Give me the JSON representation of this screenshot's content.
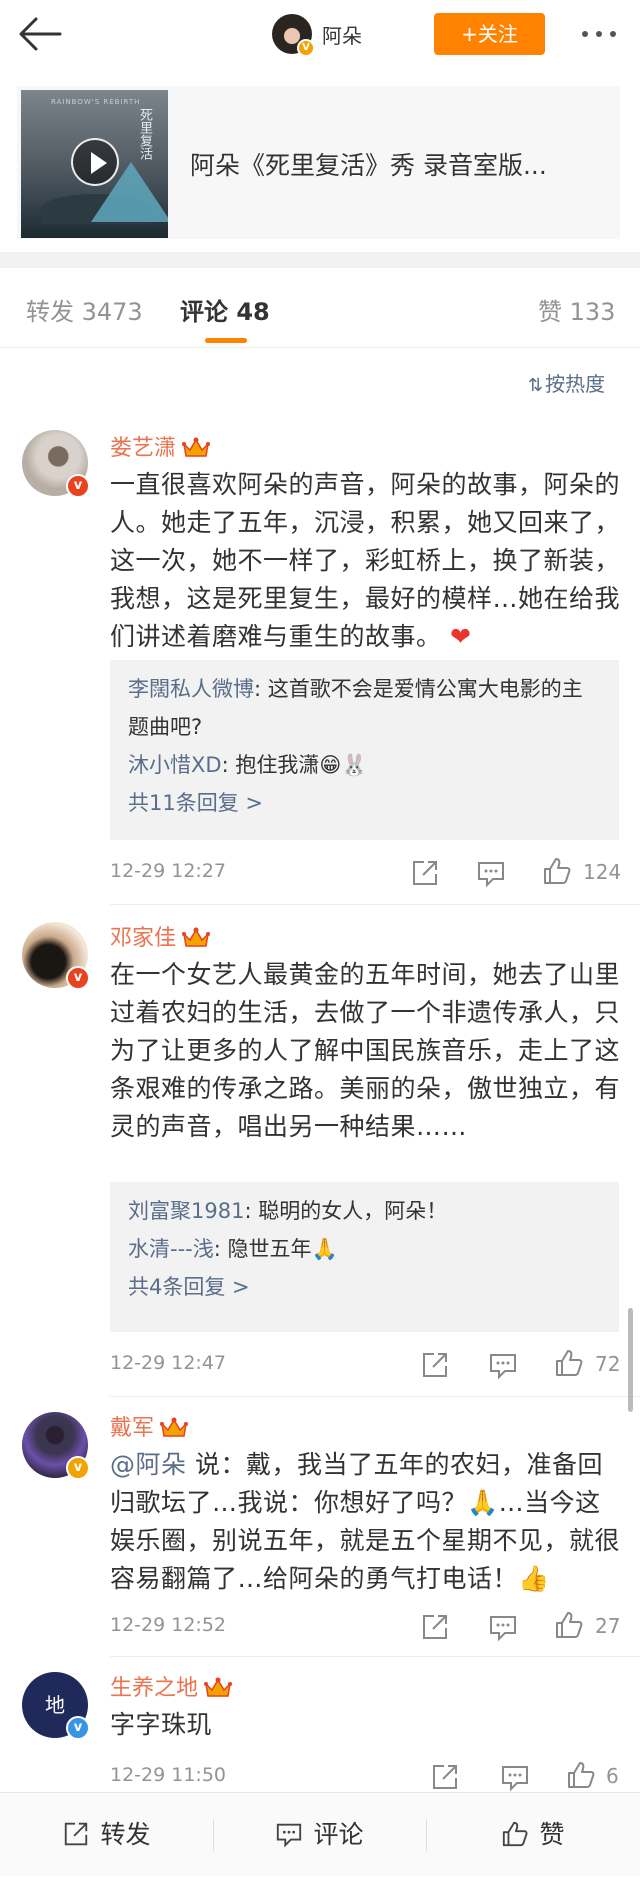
{
  "header": {
    "author": "阿朵",
    "follow_label": "+关注"
  },
  "video_card": {
    "title": "阿朵《死里复活》秀 录音室版...",
    "thumb_small_text": "RAINBOW'S REBIRTH",
    "thumb_title": "死里复活"
  },
  "tabs": {
    "repost": "转发 3473",
    "comments": "评论 48",
    "likes": "赞 133"
  },
  "sort_label": "按热度",
  "comments": [
    {
      "name": "娄艺潇",
      "text": "一直很喜欢阿朵的声音，阿朵的故事，阿朵的人。她走了五年，沉浸，积累，她又回来了，这一次，她不一样了，彩虹桥上，换了新装，我想，这是死里复生，最好的模样…她在给我们讲述着磨难与重生的故事。",
      "emoji": "❤",
      "replies": [
        {
          "name": "李闊私人微博",
          "text": ": 这首歌不会是爱情公寓大电影的主题曲吧?"
        },
        {
          "name": "沐小惜XD",
          "text": ": 抱住我潇",
          "emoji": "😁🐰"
        }
      ],
      "more_replies": "共11条回复 >",
      "time": "12-29 12:27",
      "likes": "124"
    },
    {
      "name": "邓家佳",
      "text": "在一个女艺人最黄金的五年时间，她去了山里过着农妇的生活，去做了一个非遗传承人，只为了让更多的人了解中国民族音乐，走上了这条艰难的传承之路。美丽的朵，傲世独立，有灵的声音，唱出另一种结果……",
      "replies": [
        {
          "name": "刘富聚1981",
          "text": ": 聪明的女人，阿朵！"
        },
        {
          "name": "水清---浅",
          "text": ": 隐世五年",
          "emoji": "🙏"
        }
      ],
      "more_replies": "共4条回复 >",
      "time": "12-29 12:47",
      "likes": "72"
    },
    {
      "name": "戴军",
      "mention": "@阿朵",
      "text_a": " 说：戴，我当了五年的农妇，准备回归歌坛了…我说：你想好了吗？",
      "emoji_a": "🙏",
      "text_b": "…当今这娱乐圈，别说五年，就是五个星期不见，就很容易翻篇了…给阿朵的勇气打电话！",
      "emoji_b": "👍",
      "time": "12-29 12:52",
      "likes": "27"
    },
    {
      "name": "生养之地",
      "avatar_text": "地",
      "text": "字字珠玑",
      "time": "12-29 11:50",
      "likes": "6"
    }
  ],
  "bottom_bar": {
    "repost": "转发",
    "comment": "评论",
    "like": "赞"
  },
  "colors": {
    "accent": "#ff8200",
    "name": "#eb7350",
    "link": "#596e8a",
    "meta": "#939393"
  }
}
